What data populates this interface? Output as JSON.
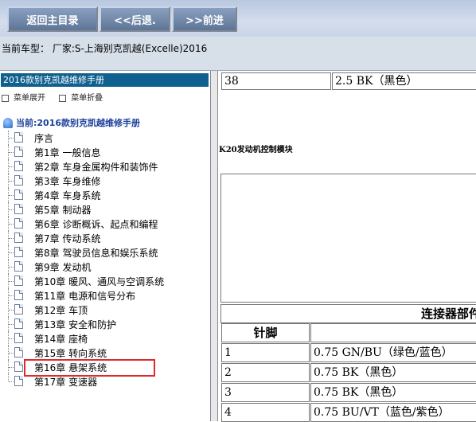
{
  "toolbar": {
    "home_label": "返回主目录",
    "back_label": "<<后退.",
    "forward_label": ">>前进"
  },
  "model_bar": {
    "text": "当前车型：  厂家:S-上海别克凯越(Excelle)2016"
  },
  "sidebar": {
    "manual_title": "2016款别克凯越维修手册",
    "expand_label": "菜单展开",
    "collapse_label": "菜单折叠",
    "root_label": "当前:2016款别克凯越维修手册",
    "items": [
      {
        "label": "序言"
      },
      {
        "label": "第1章 一般信息"
      },
      {
        "label": "第2章 车身金属构件和装饰件"
      },
      {
        "label": "第3章 车身维修"
      },
      {
        "label": "第4章 车身系统"
      },
      {
        "label": "第5章 制动器"
      },
      {
        "label": "第6章 诊断概诉、起点和编程"
      },
      {
        "label": "第7章 传动系统"
      },
      {
        "label": "第8章 驾驶员信息和娱乐系统"
      },
      {
        "label": "第9章 发动机"
      },
      {
        "label": "第10章 暖风、通风与空调系统"
      },
      {
        "label": "第11章 电源和信号分布"
      },
      {
        "label": "第12章 车顶"
      },
      {
        "label": "第13章 安全和防护"
      },
      {
        "label": "第14章 座椅"
      },
      {
        "label": "第15章 转向系统"
      },
      {
        "label": "第16章 悬架系统"
      },
      {
        "label": "第17章 变速器"
      }
    ],
    "selected_index": 11
  },
  "content": {
    "top_row": {
      "pin": "38",
      "wire": "2.5 BK（黑色）"
    },
    "module_title": "K20发动机控制模块",
    "part_header": "连接器部件",
    "pin_header": "针脚",
    "rows": [
      {
        "pin": "1",
        "wire": "0.75 GN/BU（绿色/蓝色）"
      },
      {
        "pin": "2",
        "wire": "0.75 BK（黑色）"
      },
      {
        "pin": "3",
        "wire": "0.75 BK（黑色）"
      },
      {
        "pin": "4",
        "wire": "0.75 BU/VT（蓝色/紫色）"
      }
    ]
  }
}
